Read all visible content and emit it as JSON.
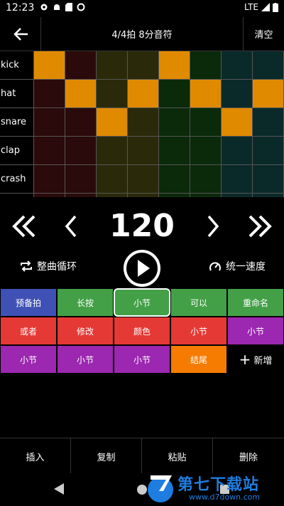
{
  "status_bar": {
    "time": "12:23",
    "network": "LTE"
  },
  "header": {
    "title": "4/4拍 8分音符",
    "clear_label": "清空"
  },
  "grid": {
    "rows": [
      {
        "label": "kick",
        "steps": [
          1,
          0,
          0,
          0,
          1,
          0,
          0,
          0
        ]
      },
      {
        "label": "hat",
        "steps": [
          0,
          1,
          0,
          1,
          0,
          1,
          0,
          1
        ]
      },
      {
        "label": "snare",
        "steps": [
          0,
          0,
          1,
          0,
          0,
          0,
          1,
          0
        ]
      },
      {
        "label": "clap",
        "steps": [
          0,
          0,
          0,
          0,
          0,
          0,
          0,
          0
        ]
      },
      {
        "label": "crash",
        "steps": [
          0,
          0,
          0,
          0,
          0,
          0,
          0,
          0
        ]
      },
      {
        "label": "",
        "steps": [
          0,
          0,
          0,
          0,
          0,
          0,
          0,
          0
        ]
      }
    ],
    "active_color": "#e08a00",
    "beat_colors": [
      "#2a0a0a",
      "#2a2a0a",
      "#0a2a0a",
      "#0a2a2a"
    ]
  },
  "tempo": {
    "bpm": "120"
  },
  "playback": {
    "loop_label": "整曲循环",
    "speed_label": "统一速度"
  },
  "sections": [
    {
      "label": "预备拍",
      "color": "#3f51b5"
    },
    {
      "label": "长按",
      "color": "#43a047"
    },
    {
      "label": "小节",
      "color": "#43a047",
      "selected": true
    },
    {
      "label": "可以",
      "color": "#43a047"
    },
    {
      "label": "重命名",
      "color": "#43a047"
    },
    {
      "label": "或者",
      "color": "#e53935"
    },
    {
      "label": "修改",
      "color": "#e53935"
    },
    {
      "label": "颜色",
      "color": "#e53935"
    },
    {
      "label": "小节",
      "color": "#e53935"
    },
    {
      "label": "小节",
      "color": "#9c27b0"
    },
    {
      "label": "小节",
      "color": "#9c27b0"
    },
    {
      "label": "小节",
      "color": "#9c27b0"
    },
    {
      "label": "小节",
      "color": "#9c27b0"
    },
    {
      "label": "结尾",
      "color": "#f57c00"
    },
    {
      "label": "新增",
      "color": "#000000",
      "add": true
    }
  ],
  "actions": [
    "插入",
    "复制",
    "粘贴",
    "删除"
  ],
  "watermark": {
    "text": "第七下载站",
    "url": "www.d7down.com"
  }
}
